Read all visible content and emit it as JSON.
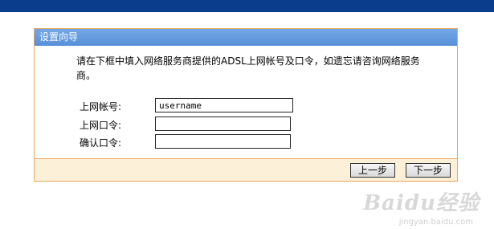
{
  "panel": {
    "title": "设置向导",
    "instruction": "请在下框中填入网络服务商提供的ADSL上网帐号及口令，如遗忘请咨询网络服务商。"
  },
  "form": {
    "account_label": "上网帐号:",
    "account_value": "username",
    "password_label": "上网口令:",
    "password_value": "",
    "confirm_label": "确认口令:",
    "confirm_value": ""
  },
  "buttons": {
    "prev": "上一步",
    "next": "下一步"
  },
  "watermark": {
    "text": "Baidu经验",
    "sub": "jingyan.baidu.com"
  },
  "colors": {
    "topbar": "#0a3e8c",
    "panel_border": "#e8a75a",
    "title_bg": "#5890d8",
    "footer_bg": "#fdf0d8"
  }
}
